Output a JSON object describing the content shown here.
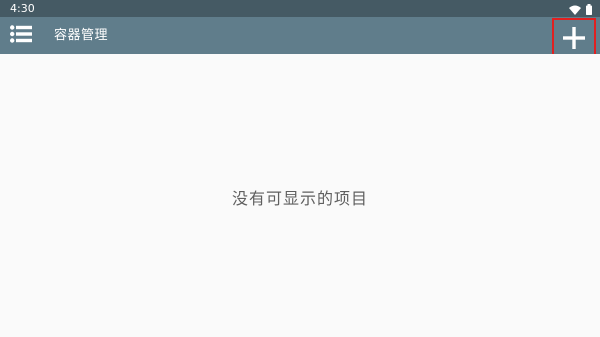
{
  "status_bar": {
    "time": "4:30",
    "icons": [
      "wifi-icon",
      "battery-icon"
    ]
  },
  "toolbar": {
    "title": "容器管理",
    "menu_icon": "menu-list-icon",
    "add_icon": "plus-icon",
    "background_color": "#607d8b",
    "highlight_color": "#e02020"
  },
  "main": {
    "empty_message": "没有可显示的项目"
  }
}
